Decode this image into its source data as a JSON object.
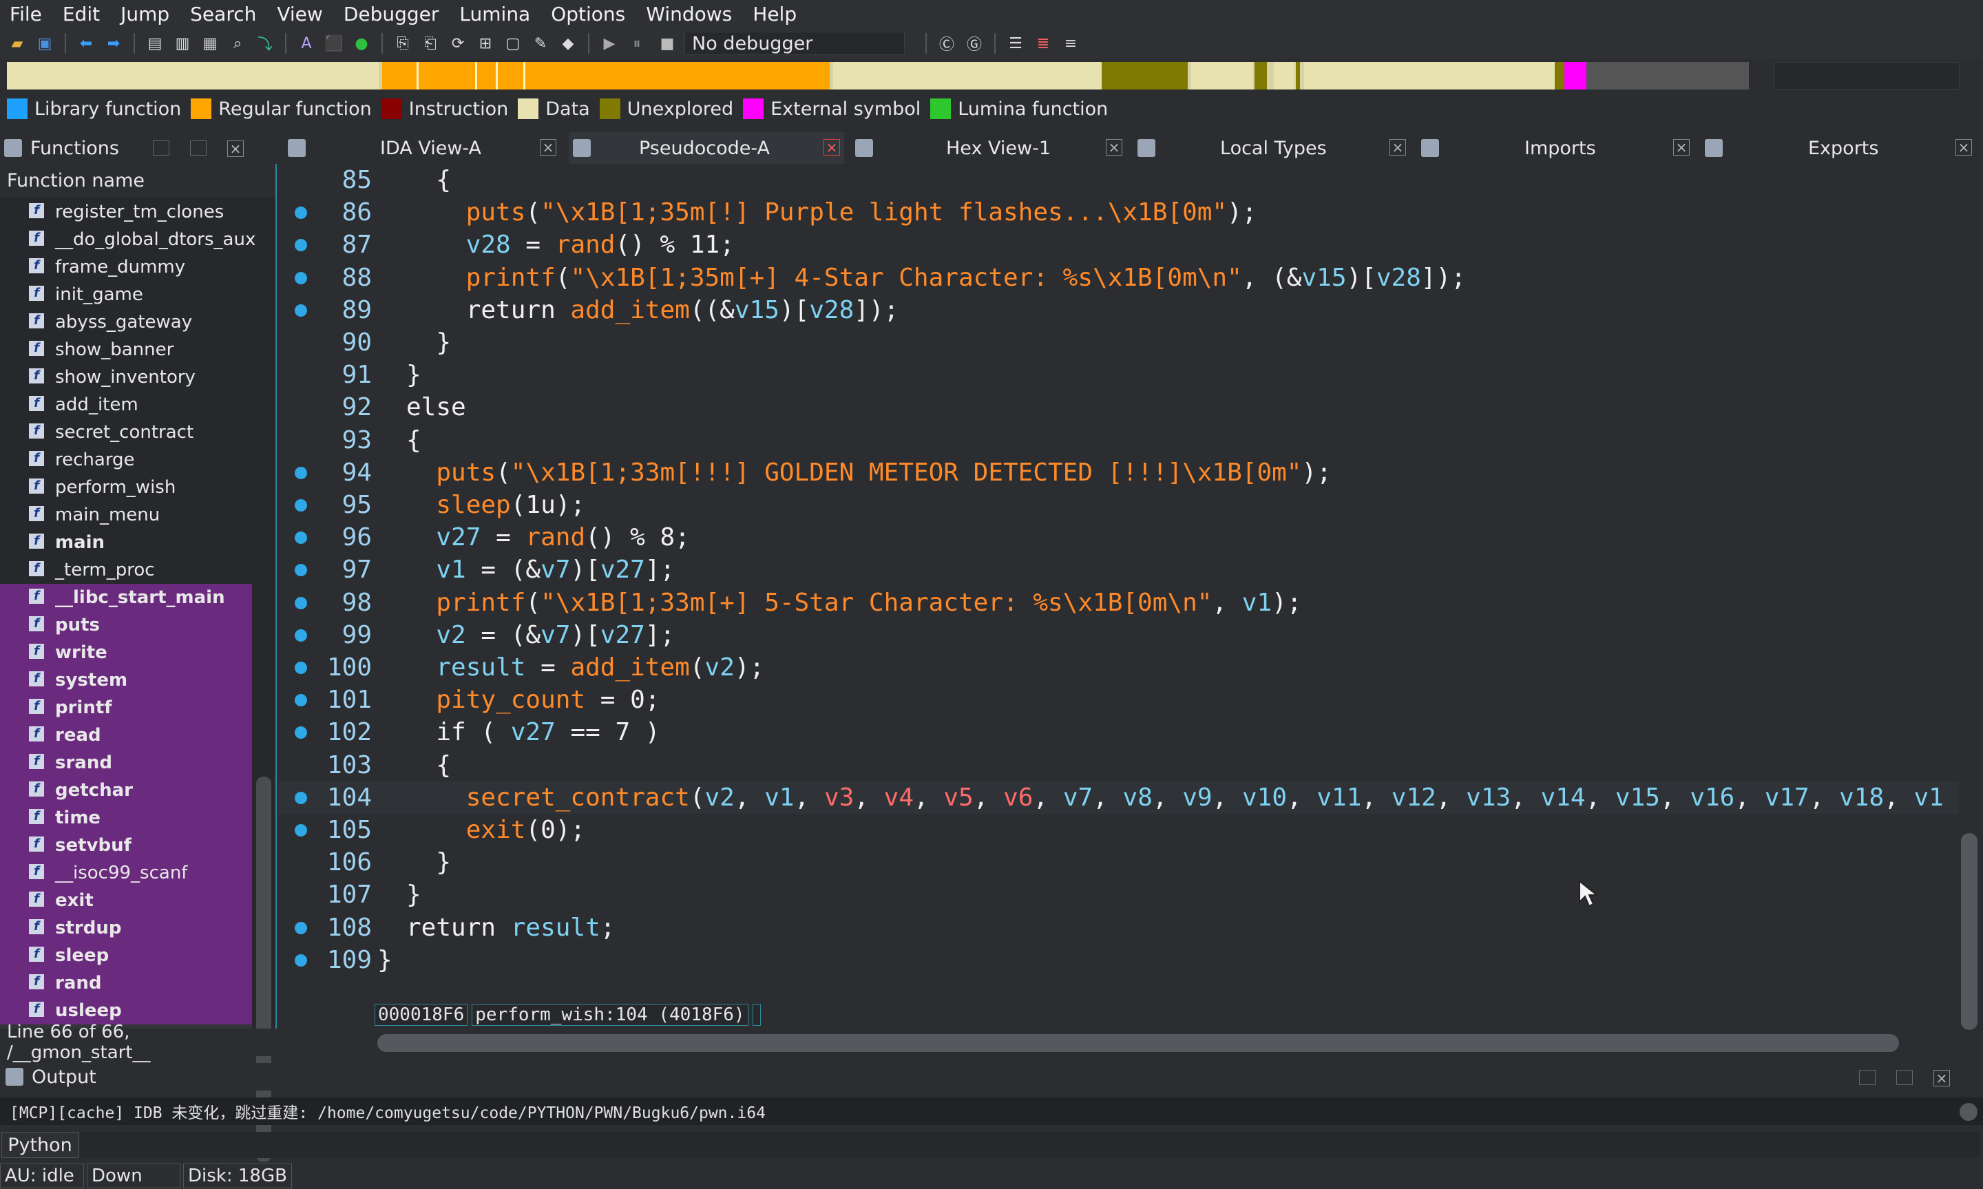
{
  "menu": [
    "File",
    "Edit",
    "Jump",
    "Search",
    "View",
    "Debugger",
    "Lumina",
    "Options",
    "Windows",
    "Help"
  ],
  "toolbar": {
    "debugger_label": "No debugger"
  },
  "legend": [
    {
      "label": "Library function",
      "color": "#1ea0ff"
    },
    {
      "label": "Regular function",
      "color": "#ffa500"
    },
    {
      "label": "Instruction",
      "color": "#8b0000"
    },
    {
      "label": "Data",
      "color": "#e8e2b0"
    },
    {
      "label": "Unexplored",
      "color": "#807a00"
    },
    {
      "label": "External symbol",
      "color": "#ff00ff"
    },
    {
      "label": "Lumina function",
      "color": "#2ec72e"
    }
  ],
  "tabs": {
    "functions": "Functions",
    "ida_view": "IDA View-A",
    "pseudocode": "Pseudocode-A",
    "hex_view": "Hex View-1",
    "local_types": "Local Types",
    "imports": "Imports",
    "exports": "Exports"
  },
  "functions": {
    "header": "Function name",
    "items": [
      {
        "name": "register_tm_clones",
        "bold": false,
        "lib": false
      },
      {
        "name": "__do_global_dtors_aux",
        "bold": false,
        "lib": false
      },
      {
        "name": "frame_dummy",
        "bold": false,
        "lib": false
      },
      {
        "name": "init_game",
        "bold": false,
        "lib": false
      },
      {
        "name": "abyss_gateway",
        "bold": false,
        "lib": false
      },
      {
        "name": "show_banner",
        "bold": false,
        "lib": false
      },
      {
        "name": "show_inventory",
        "bold": false,
        "lib": false
      },
      {
        "name": "add_item",
        "bold": false,
        "lib": false
      },
      {
        "name": "secret_contract",
        "bold": false,
        "lib": false
      },
      {
        "name": "recharge",
        "bold": false,
        "lib": false
      },
      {
        "name": "perform_wish",
        "bold": false,
        "lib": false
      },
      {
        "name": "main_menu",
        "bold": false,
        "lib": false
      },
      {
        "name": "main",
        "bold": true,
        "lib": false
      },
      {
        "name": "_term_proc",
        "bold": false,
        "lib": false
      },
      {
        "name": "__libc_start_main",
        "bold": true,
        "lib": true
      },
      {
        "name": "puts",
        "bold": true,
        "lib": true
      },
      {
        "name": "write",
        "bold": true,
        "lib": true
      },
      {
        "name": "system",
        "bold": true,
        "lib": true
      },
      {
        "name": "printf",
        "bold": true,
        "lib": true
      },
      {
        "name": "read",
        "bold": true,
        "lib": true
      },
      {
        "name": "srand",
        "bold": true,
        "lib": true
      },
      {
        "name": "getchar",
        "bold": true,
        "lib": true
      },
      {
        "name": "time",
        "bold": true,
        "lib": true
      },
      {
        "name": "setvbuf",
        "bold": true,
        "lib": true
      },
      {
        "name": "__isoc99_scanf",
        "bold": false,
        "lib": true
      },
      {
        "name": "exit",
        "bold": true,
        "lib": true
      },
      {
        "name": "strdup",
        "bold": true,
        "lib": true
      },
      {
        "name": "sleep",
        "bold": true,
        "lib": true
      },
      {
        "name": "rand",
        "bold": true,
        "lib": true
      },
      {
        "name": "usleep",
        "bold": true,
        "lib": true
      },
      {
        "name": "__gmon_start__",
        "bold": false,
        "lib": false
      }
    ],
    "status": "Line 66 of 66, /__gmon_start__"
  },
  "code": {
    "lines": [
      {
        "no": "85",
        "dot": false,
        "html": "  <span class='kw'>{</span>"
      },
      {
        "no": "86",
        "dot": true,
        "html": "    <span class='fnc'>puts</span><span class='op'>(</span><span class='str'>\"\\x1B[1;35m[!] Purple light flashes...\\x1B[0m\"</span><span class='op'>);</span>"
      },
      {
        "no": "87",
        "dot": true,
        "html": "    <span class='var'>v28</span><span class='op'> = </span><span class='fnc'>rand</span><span class='op'>() % 11;</span>"
      },
      {
        "no": "88",
        "dot": true,
        "html": "    <span class='fnc'>printf</span><span class='op'>(</span><span class='str'>\"\\x1B[1;35m[+] 4-Star Character: %s\\x1B[0m\\n\"</span><span class='op'>, (&amp;</span><span class='var'>v15</span><span class='op'>)[</span><span class='var'>v28</span><span class='op'>]);</span>"
      },
      {
        "no": "89",
        "dot": true,
        "html": "    <span class='kw'>return </span><span class='fnc'>add_item</span><span class='op'>((&amp;</span><span class='var'>v15</span><span class='op'>)[</span><span class='var'>v28</span><span class='op'>]);</span>"
      },
      {
        "no": "90",
        "dot": false,
        "html": "  <span class='kw'>}</span>"
      },
      {
        "no": "91",
        "dot": false,
        "html": "<span class='kw'>}</span>"
      },
      {
        "no": "92",
        "dot": false,
        "html": "<span class='kw'>else</span>"
      },
      {
        "no": "93",
        "dot": false,
        "html": "<span class='kw'>{</span>"
      },
      {
        "no": "94",
        "dot": true,
        "html": "  <span class='fnc'>puts</span><span class='op'>(</span><span class='str'>\"\\x1B[1;33m[!!!] GOLDEN METEOR DETECTED [!!!]\\x1B[0m\"</span><span class='op'>);</span>"
      },
      {
        "no": "95",
        "dot": true,
        "html": "  <span class='fnc'>sleep</span><span class='op'>(1u);</span>"
      },
      {
        "no": "96",
        "dot": true,
        "html": "  <span class='var'>v27</span><span class='op'> = </span><span class='fnc'>rand</span><span class='op'>() % 8;</span>"
      },
      {
        "no": "97",
        "dot": true,
        "html": "  <span class='var'>v1</span><span class='op'> = (&amp;</span><span class='var'>v7</span><span class='op'>)[</span><span class='var'>v27</span><span class='op'>];</span>"
      },
      {
        "no": "98",
        "dot": true,
        "html": "  <span class='fnc'>printf</span><span class='op'>(</span><span class='str'>\"\\x1B[1;33m[+] 5-Star Character: %s\\x1B[0m\\n\"</span><span class='op'>, </span><span class='var'>v1</span><span class='op'>);</span>"
      },
      {
        "no": "99",
        "dot": true,
        "html": "  <span class='var'>v2</span><span class='op'> = (&amp;</span><span class='var'>v7</span><span class='op'>)[</span><span class='var'>v27</span><span class='op'>];</span>"
      },
      {
        "no": "100",
        "dot": true,
        "html": "  <span class='var'>result</span><span class='op'> = </span><span class='fnc'>add_item</span><span class='op'>(</span><span class='var'>v2</span><span class='op'>);</span>"
      },
      {
        "no": "101",
        "dot": true,
        "html": "  <span class='gl'>pity_count</span><span class='op'> = 0;</span>"
      },
      {
        "no": "102",
        "dot": true,
        "html": "  <span class='kw'>if</span><span class='op'> ( </span><span class='var'>v27</span><span class='op'> == 7 )</span>"
      },
      {
        "no": "103",
        "dot": false,
        "html": "  <span class='kw'>{</span>"
      },
      {
        "no": "104",
        "dot": true,
        "cur": true,
        "html": "    <span class='fnc'>secret_contract</span><span class='op'>(</span><span class='var'>v2</span><span class='op'>, </span><span class='var'>v1</span><span class='op'>, </span><span class='red'>v3</span><span class='op'>, </span><span class='red'>v4</span><span class='op'>, </span><span class='red'>v5</span><span class='op'>, </span><span class='red'>v6</span><span class='op'>, </span><span class='var'>v7</span><span class='op'>, </span><span class='var'>v8</span><span class='op'>, </span><span class='var'>v9</span><span class='op'>, </span><span class='var'>v10</span><span class='op'>, </span><span class='var'>v11</span><span class='op'>, </span><span class='var'>v12</span><span class='op'>, </span><span class='var'>v13</span><span class='op'>, </span><span class='var'>v14</span><span class='op'>, </span><span class='var'>v15</span><span class='op'>, </span><span class='var'>v16</span><span class='op'>, </span><span class='var'>v17</span><span class='op'>, </span><span class='var'>v18</span><span class='op'>, </span><span class='var'>v1</span>"
      },
      {
        "no": "105",
        "dot": true,
        "html": "    <span class='fnc'>exit</span><span class='op'>(0);</span>"
      },
      {
        "no": "106",
        "dot": false,
        "html": "  <span class='kw'>}</span>"
      },
      {
        "no": "107",
        "dot": false,
        "html": "<span class='kw'>}</span>"
      },
      {
        "no": "108",
        "dot": true,
        "html": "<span class='kw'>return </span><span class='var'>result</span><span class='op'>;</span>"
      },
      {
        "no": "109",
        "dot": true,
        "html": "<span class='kw' style='margin-left:-42px'>}</span>"
      }
    ],
    "address": "000018F6",
    "location": "perform_wish:104 (4018F6)"
  },
  "output": {
    "title": "Output",
    "log": "[MCP][cache] IDB 未变化，跳过重建: /home/comyugetsu/code/PYTHON/PWN/Bugku6/pwn.i64",
    "python_label": "Python"
  },
  "status": {
    "au": "AU:  idle",
    "direction": "Down",
    "disk": "Disk: 18GB"
  }
}
